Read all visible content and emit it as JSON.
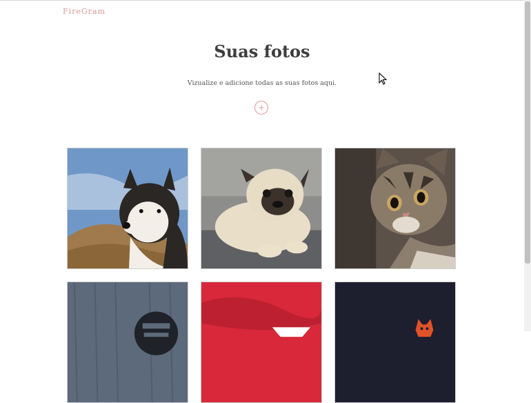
{
  "header": {
    "brand": "FireGram"
  },
  "main": {
    "title": "Suas fotos",
    "subtitle": "Vizualize e adicione todas as suas fotos aqui.",
    "add_button": "+"
  },
  "gallery": {
    "photos": [
      {
        "subject": "husky-dog"
      },
      {
        "subject": "pug-dog"
      },
      {
        "subject": "tabby-cat"
      },
      {
        "subject": "dark-logo"
      },
      {
        "subject": "red-logo"
      },
      {
        "subject": "navy-fox-logo"
      }
    ]
  }
}
